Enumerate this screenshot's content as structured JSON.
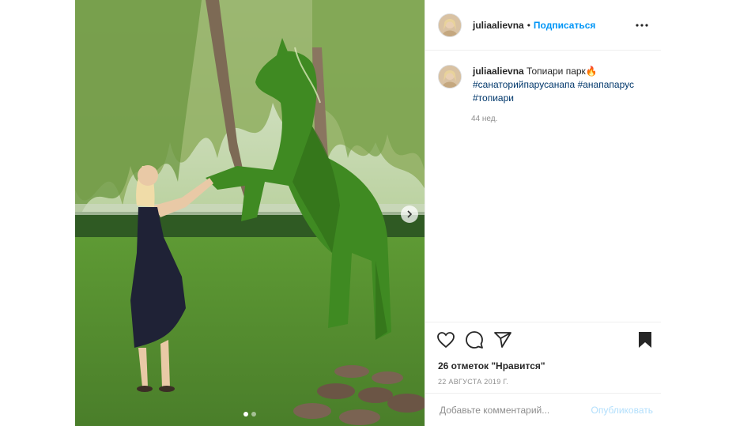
{
  "post": {
    "username": "juliaalievna",
    "separator": "•",
    "follow_label": "Подписаться",
    "caption_text": "Топиари парк🔥",
    "hashtags": [
      "#санаторийпарусанапа",
      "#анапапарус",
      "#топиари"
    ],
    "age": "44 нед.",
    "likes": "26 отметок \"Нравится\"",
    "date": "22 АВГУСТА 2019 Г.",
    "comment_placeholder": "Добавьте комментарий...",
    "publish_label": "Опубликовать"
  },
  "icons": {
    "more": "more-options-icon",
    "like": "heart-icon",
    "comment": "comment-bubble-icon",
    "share": "share-plane-icon",
    "save": "bookmark-icon",
    "next": "chevron-right-icon"
  },
  "carousel": {
    "count": 2,
    "active": 1
  },
  "colors": {
    "link_blue": "#0095f6",
    "hashtag": "#00376b",
    "muted": "#8e8e8e",
    "publish_disabled": "#b2dffc"
  }
}
